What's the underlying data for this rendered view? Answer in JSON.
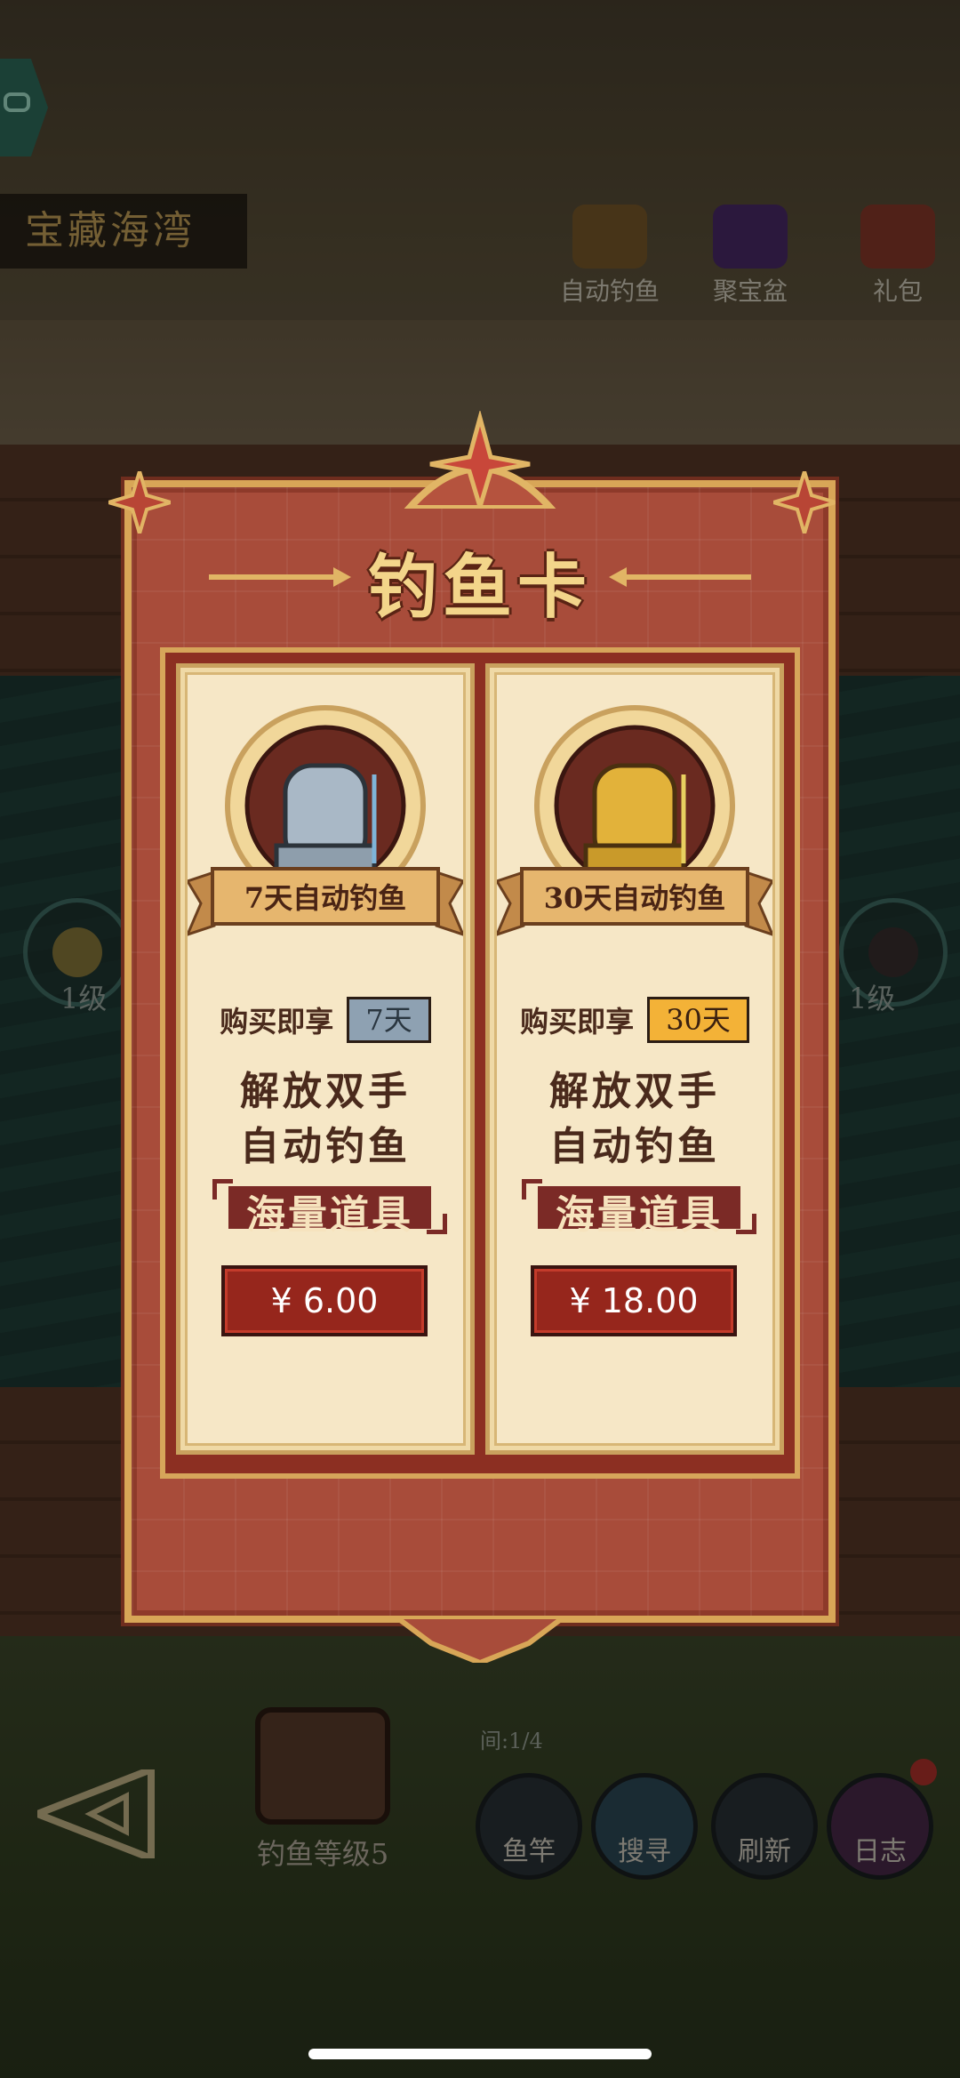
{
  "scene": {
    "map_name": "宝藏海湾",
    "top_icons": [
      {
        "label": "自动钓鱼",
        "icon": "cat-fisher-icon"
      },
      {
        "label": "聚宝盆",
        "icon": "treasure-bowl-icon"
      },
      {
        "label": "礼包",
        "icon": "gift-chest-icon"
      }
    ],
    "left_bubble_level": "1级",
    "right_bubble_level": "1级",
    "fishing_level": "钓鱼等级5",
    "catch_count": "间:1/4",
    "actions": [
      {
        "label": "鱼竿",
        "icon": "fishing-rod-icon"
      },
      {
        "label": "搜寻",
        "icon": "search-orb-icon"
      },
      {
        "label": "刷新",
        "icon": "refresh-bottle-icon"
      },
      {
        "label": "日志",
        "icon": "log-book-icon"
      }
    ]
  },
  "modal": {
    "title": "钓鱼卡",
    "cards": [
      {
        "ribbon": "7天自动钓鱼",
        "perk_label": "购买即享",
        "perk_badge": "7天",
        "line1": "解放双手",
        "line2": "自动钓鱼",
        "banner": "海量道具",
        "price": "¥ 6.00",
        "tier_color": "#a9b8c6"
      },
      {
        "ribbon": "30天自动钓鱼",
        "perk_label": "购买即享",
        "perk_badge": "30天",
        "line1": "解放双手",
        "line2": "自动钓鱼",
        "banner": "海量道具",
        "price": "¥ 18.00",
        "tier_color": "#e2b23a"
      }
    ]
  }
}
